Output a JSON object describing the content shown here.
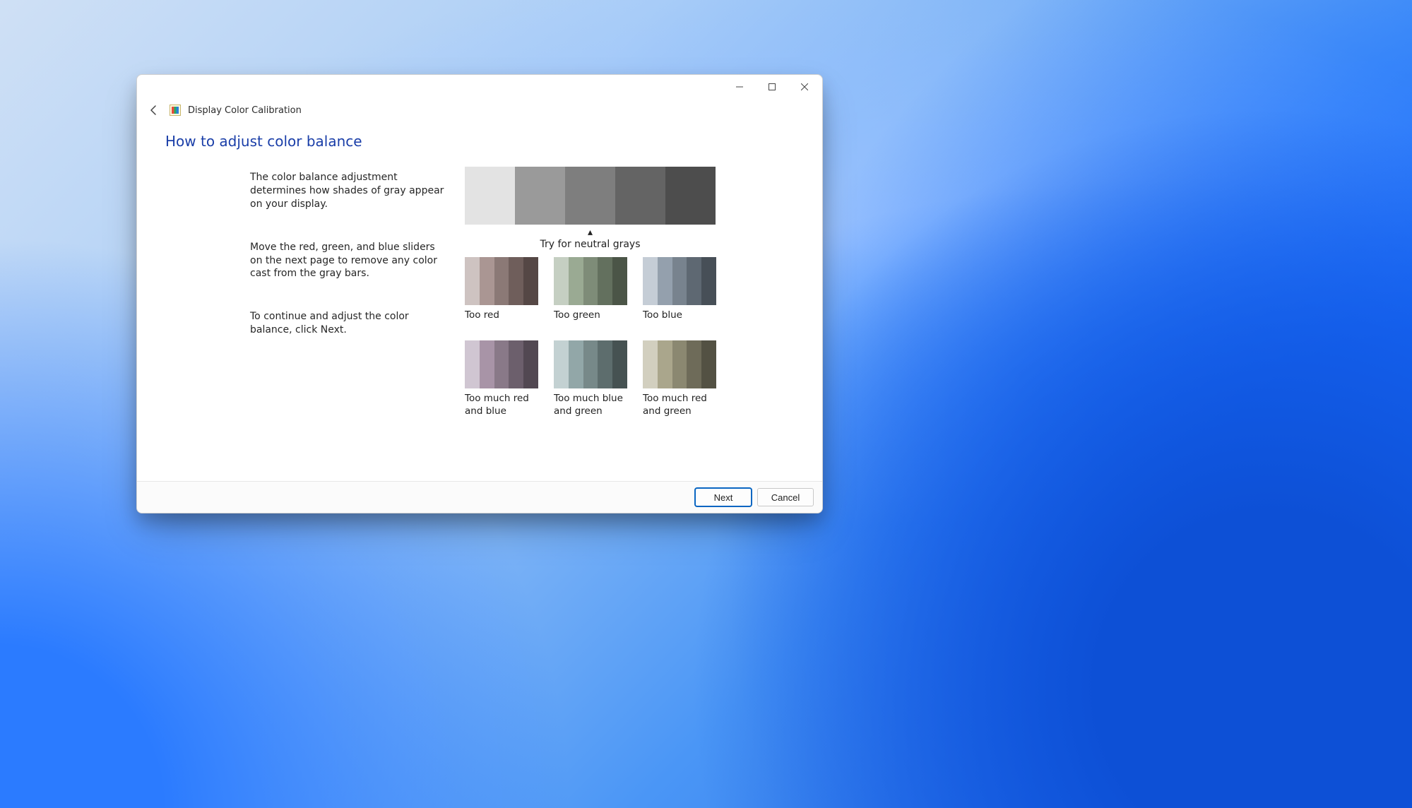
{
  "window": {
    "title": "Display Color Calibration"
  },
  "page": {
    "heading": "How to adjust color balance",
    "para1": "The color balance adjustment determines how shades of gray appear on your display.",
    "para2": "Move the red, green, and blue sliders on the next page to remove any color cast from the gray bars.",
    "para3": "To continue and adjust the color balance, click Next.",
    "try_caption": "Try for neutral grays"
  },
  "neutral_bar_colors": [
    "#e3e3e3",
    "#9a9a9a",
    "#7e7e7e",
    "#646464",
    "#4d4d4d"
  ],
  "swatches": [
    {
      "key": "too-red",
      "label": "Too red",
      "colors": [
        "#cec3c1",
        "#aa9693",
        "#8b7976",
        "#6f5e5b",
        "#554745"
      ]
    },
    {
      "key": "too-green",
      "label": "Too green",
      "colors": [
        "#c5cfc2",
        "#9aaa93",
        "#7e8c78",
        "#63705e",
        "#4b5547"
      ]
    },
    {
      "key": "too-blue",
      "label": "Too blue",
      "colors": [
        "#c5cdd6",
        "#94a0ad",
        "#78838e",
        "#5e6872",
        "#474f57"
      ]
    },
    {
      "key": "too-red-blue",
      "label": "Too much red and blue",
      "colors": [
        "#d0c6d2",
        "#a894a7",
        "#897988",
        "#6c5f6c",
        "#524852"
      ]
    },
    {
      "key": "too-blue-green",
      "label": "Too much blue and green",
      "colors": [
        "#c3d1d2",
        "#92a7a8",
        "#778989",
        "#5d6d6d",
        "#465252"
      ]
    },
    {
      "key": "too-red-green",
      "label": "Too much red and green",
      "colors": [
        "#d2cfbf",
        "#aaa68c",
        "#8b8871",
        "#6e6b59",
        "#535143"
      ]
    }
  ],
  "footer": {
    "next": "Next",
    "cancel": "Cancel"
  }
}
